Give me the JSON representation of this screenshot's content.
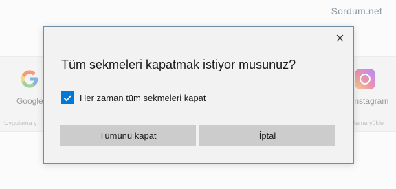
{
  "watermark": "Sordum.net",
  "background": {
    "tiles": [
      {
        "label": "Google",
        "icon": "google-g-icon"
      },
      {
        "label": "Instagram",
        "icon": "instagram-icon"
      }
    ],
    "sub_left": "Uygulama y",
    "sub_right": "ulama yükle"
  },
  "dialog": {
    "title": "Tüm sekmeleri kapatmak istiyor musunuz?",
    "checkbox": {
      "label": "Her zaman tüm sekmeleri kapat",
      "checked": true
    },
    "buttons": {
      "close_all": "Tümünü kapat",
      "cancel": "İptal"
    },
    "close_icon": "close-icon"
  },
  "colors": {
    "accent": "#0078d7",
    "dialog_border": "#6f8ea6",
    "button_bg": "#cccccc"
  }
}
